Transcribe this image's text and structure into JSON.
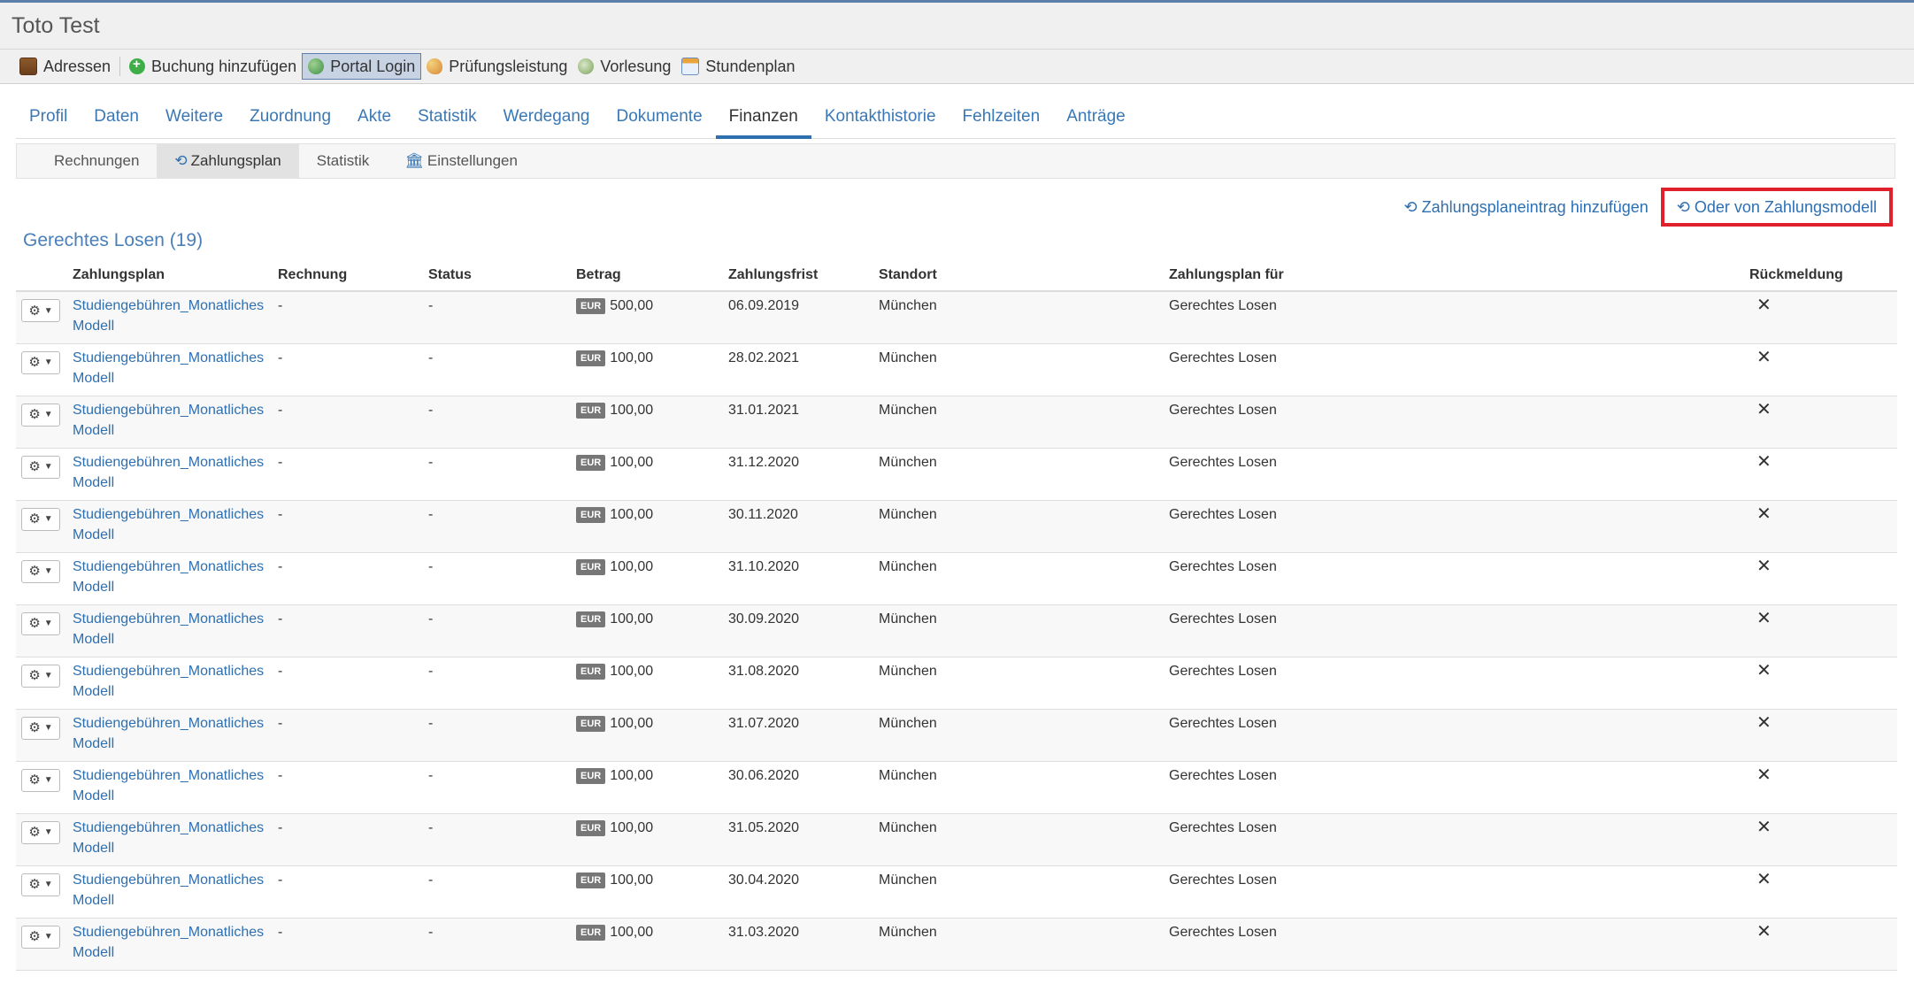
{
  "window": {
    "title": "Toto Test"
  },
  "toolbar": {
    "items": [
      {
        "label": "Adressen",
        "icon": "address-book-icon"
      },
      {
        "label": "Buchung hinzufügen",
        "icon": "add-booking-icon"
      },
      {
        "label": "Portal Login",
        "icon": "globe-icon",
        "active": true
      },
      {
        "label": "Prüfungsleistung",
        "icon": "palette-icon"
      },
      {
        "label": "Vorlesung",
        "icon": "lecture-icon"
      },
      {
        "label": "Stundenplan",
        "icon": "calendar-icon"
      }
    ]
  },
  "tabs": [
    {
      "label": "Profil"
    },
    {
      "label": "Daten"
    },
    {
      "label": "Weitere"
    },
    {
      "label": "Zuordnung"
    },
    {
      "label": "Akte"
    },
    {
      "label": "Statistik"
    },
    {
      "label": "Werdegang"
    },
    {
      "label": "Dokumente"
    },
    {
      "label": "Finanzen",
      "active": true
    },
    {
      "label": "Kontakthistorie"
    },
    {
      "label": "Fehlzeiten"
    },
    {
      "label": "Anträge"
    }
  ],
  "subtabs": [
    {
      "label": "Rechnungen"
    },
    {
      "label": "Zahlungsplan",
      "icon": "history-icon",
      "active": true
    },
    {
      "label": "Statistik"
    },
    {
      "label": "Einstellungen",
      "icon": "bank-icon"
    }
  ],
  "actions": {
    "add_entry": "Zahlungsplaneintrag hinzufügen",
    "from_model": "Oder von Zahlungsmodell"
  },
  "section": {
    "title": "Gerechtes Losen (19)"
  },
  "table": {
    "headers": [
      "Zahlungsplan",
      "Rechnung",
      "Status",
      "Betrag",
      "Zahlungsfrist",
      "Standort",
      "Zahlungsplan für",
      "Rückmeldung"
    ],
    "currency": "EUR",
    "rows": [
      {
        "plan_line1": "Studiengebühren_Monatliches",
        "plan_line2": "Modell",
        "rechnung": "-",
        "status": "-",
        "betrag": "500,00",
        "frist": "06.09.2019",
        "standort": "München",
        "fuer": "Gerechtes Losen",
        "rueck": "✕"
      },
      {
        "plan_line1": "Studiengebühren_Monatliches",
        "plan_line2": "Modell",
        "rechnung": "-",
        "status": "-",
        "betrag": "100,00",
        "frist": "28.02.2021",
        "standort": "München",
        "fuer": "Gerechtes Losen",
        "rueck": "✕"
      },
      {
        "plan_line1": "Studiengebühren_Monatliches",
        "plan_line2": "Modell",
        "rechnung": "-",
        "status": "-",
        "betrag": "100,00",
        "frist": "31.01.2021",
        "standort": "München",
        "fuer": "Gerechtes Losen",
        "rueck": "✕"
      },
      {
        "plan_line1": "Studiengebühren_Monatliches",
        "plan_line2": "Modell",
        "rechnung": "-",
        "status": "-",
        "betrag": "100,00",
        "frist": "31.12.2020",
        "standort": "München",
        "fuer": "Gerechtes Losen",
        "rueck": "✕"
      },
      {
        "plan_line1": "Studiengebühren_Monatliches",
        "plan_line2": "Modell",
        "rechnung": "-",
        "status": "-",
        "betrag": "100,00",
        "frist": "30.11.2020",
        "standort": "München",
        "fuer": "Gerechtes Losen",
        "rueck": "✕"
      },
      {
        "plan_line1": "Studiengebühren_Monatliches",
        "plan_line2": "Modell",
        "rechnung": "-",
        "status": "-",
        "betrag": "100,00",
        "frist": "31.10.2020",
        "standort": "München",
        "fuer": "Gerechtes Losen",
        "rueck": "✕"
      },
      {
        "plan_line1": "Studiengebühren_Monatliches",
        "plan_line2": "Modell",
        "rechnung": "-",
        "status": "-",
        "betrag": "100,00",
        "frist": "30.09.2020",
        "standort": "München",
        "fuer": "Gerechtes Losen",
        "rueck": "✕"
      },
      {
        "plan_line1": "Studiengebühren_Monatliches",
        "plan_line2": "Modell",
        "rechnung": "-",
        "status": "-",
        "betrag": "100,00",
        "frist": "31.08.2020",
        "standort": "München",
        "fuer": "Gerechtes Losen",
        "rueck": "✕"
      },
      {
        "plan_line1": "Studiengebühren_Monatliches",
        "plan_line2": "Modell",
        "rechnung": "-",
        "status": "-",
        "betrag": "100,00",
        "frist": "31.07.2020",
        "standort": "München",
        "fuer": "Gerechtes Losen",
        "rueck": "✕"
      },
      {
        "plan_line1": "Studiengebühren_Monatliches",
        "plan_line2": "Modell",
        "rechnung": "-",
        "status": "-",
        "betrag": "100,00",
        "frist": "30.06.2020",
        "standort": "München",
        "fuer": "Gerechtes Losen",
        "rueck": "✕"
      },
      {
        "plan_line1": "Studiengebühren_Monatliches",
        "plan_line2": "Modell",
        "rechnung": "-",
        "status": "-",
        "betrag": "100,00",
        "frist": "31.05.2020",
        "standort": "München",
        "fuer": "Gerechtes Losen",
        "rueck": "✕"
      },
      {
        "plan_line1": "Studiengebühren_Monatliches",
        "plan_line2": "Modell",
        "rechnung": "-",
        "status": "-",
        "betrag": "100,00",
        "frist": "30.04.2020",
        "standort": "München",
        "fuer": "Gerechtes Losen",
        "rueck": "✕"
      },
      {
        "plan_line1": "Studiengebühren_Monatliches",
        "plan_line2": "Modell",
        "rechnung": "-",
        "status": "-",
        "betrag": "100,00",
        "frist": "31.03.2020",
        "standort": "München",
        "fuer": "Gerechtes Losen",
        "rueck": "✕"
      }
    ]
  },
  "colors": {
    "link": "#2e6fb0",
    "highlight_border": "#e0202b",
    "active_tab_underline": "#2e6fb0"
  }
}
